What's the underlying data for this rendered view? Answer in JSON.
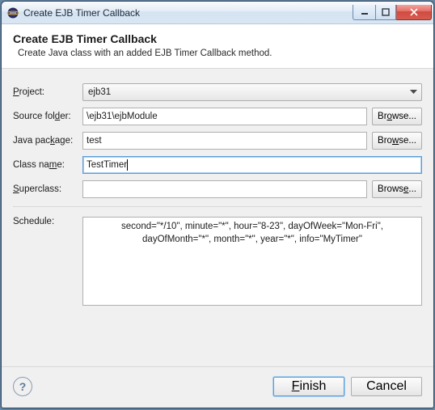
{
  "window": {
    "title": "Create EJB Timer Callback"
  },
  "header": {
    "title": "Create EJB Timer Callback",
    "subtitle": "Create Java class with an added EJB Timer Callback method."
  },
  "form": {
    "project": {
      "label_pre": "P",
      "label_rest": "roject:",
      "value": "ejb31"
    },
    "sourceFolder": {
      "label_pre": "Source fol",
      "label_u": "d",
      "label_post": "er:",
      "value": "\\ejb31\\ejbModule",
      "browse_pre": "Br",
      "browse_u": "o",
      "browse_post": "wse..."
    },
    "javaPackage": {
      "label_pre": "Java pac",
      "label_u": "k",
      "label_post": "age:",
      "value": "test",
      "browse_pre": "Bro",
      "browse_u": "w",
      "browse_post": "se..."
    },
    "className": {
      "label_pre": "Class na",
      "label_u": "m",
      "label_post": "e:",
      "value": "TestTimer"
    },
    "superclass": {
      "label_u": "S",
      "label_post": "uperclass:",
      "value": "",
      "browse_pre": "Brows",
      "browse_u": "e",
      "browse_post": "..."
    },
    "schedule": {
      "label": "Schedule:",
      "value": "second=\"*/10\", minute=\"*\", hour=\"8-23\", dayOfWeek=\"Mon-Fri\", dayOfMonth=\"*\", month=\"*\", year=\"*\", info=\"MyTimer\""
    }
  },
  "footer": {
    "help": "?",
    "finish_u": "F",
    "finish_post": "inish",
    "cancel": "Cancel"
  }
}
